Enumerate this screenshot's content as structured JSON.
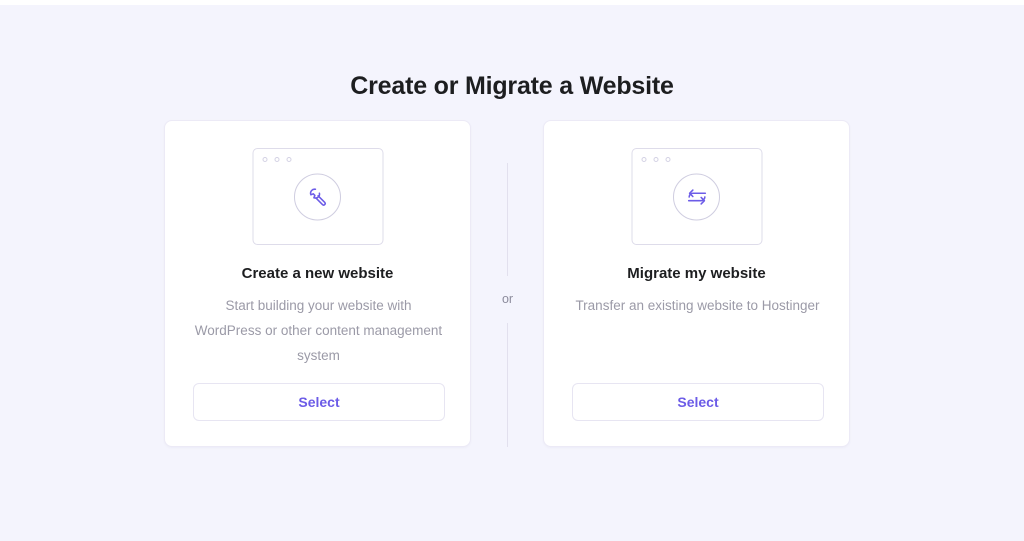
{
  "page": {
    "title": "Create or Migrate a Website",
    "background_color": "#f4f4fd",
    "divider_label": "or"
  },
  "theme": {
    "accent_color": "#6c5ce7",
    "heading_color": "#1d1e20",
    "muted_text_color": "#9b9aa7",
    "card_background": "#ffffff",
    "card_border_color": "#eceaf6"
  },
  "cards": [
    {
      "id": "create-new-website",
      "icon": "wrench-icon",
      "illustration": "browser-window-illustration",
      "window_dots": 3,
      "title": "Create a new website",
      "description": "Start building your website with WordPress or other content management system",
      "button_label": "Select"
    },
    {
      "id": "migrate-my-website",
      "icon": "transfer-arrows-icon",
      "illustration": "browser-window-illustration",
      "window_dots": 3,
      "title": "Migrate my website",
      "description": "Transfer an existing website to Hostinger",
      "button_label": "Select"
    }
  ]
}
